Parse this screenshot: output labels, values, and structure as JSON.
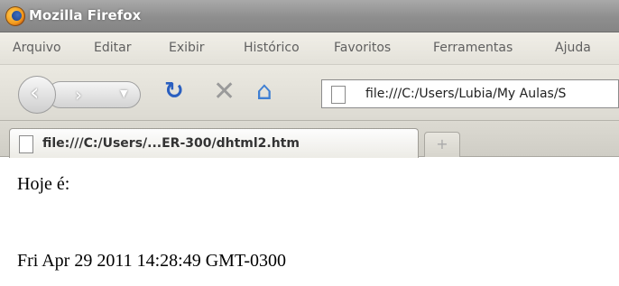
{
  "window": {
    "title": "Mozilla Firefox",
    "app_icon": "firefox-logo"
  },
  "menubar": {
    "items": [
      "Arquivo",
      "Editar",
      "Exibir",
      "Histórico",
      "Favoritos",
      "Ferramentas",
      "Ajuda"
    ]
  },
  "navbar": {
    "back_icon": "back-arrow",
    "forward_icon": "forward-arrow",
    "history_dropdown_icon": "chevron-down",
    "reload_icon": "reload",
    "stop_icon": "stop",
    "home_icon": "home",
    "url": "file:///C:/Users/Lubia/My Aulas/S"
  },
  "tabs": {
    "active_label": "file:///C:/Users/...ER-300/dhtml2.htm",
    "new_tab_symbol": "+"
  },
  "content": {
    "line1": "Hoje é:",
    "line2": "Fri Apr 29 2011 14:28:49 GMT-0300"
  },
  "colors": {
    "titlebar": "#8e8e8e",
    "reload_blue": "#2a5fc0",
    "home_blue": "#3f7fd3"
  }
}
